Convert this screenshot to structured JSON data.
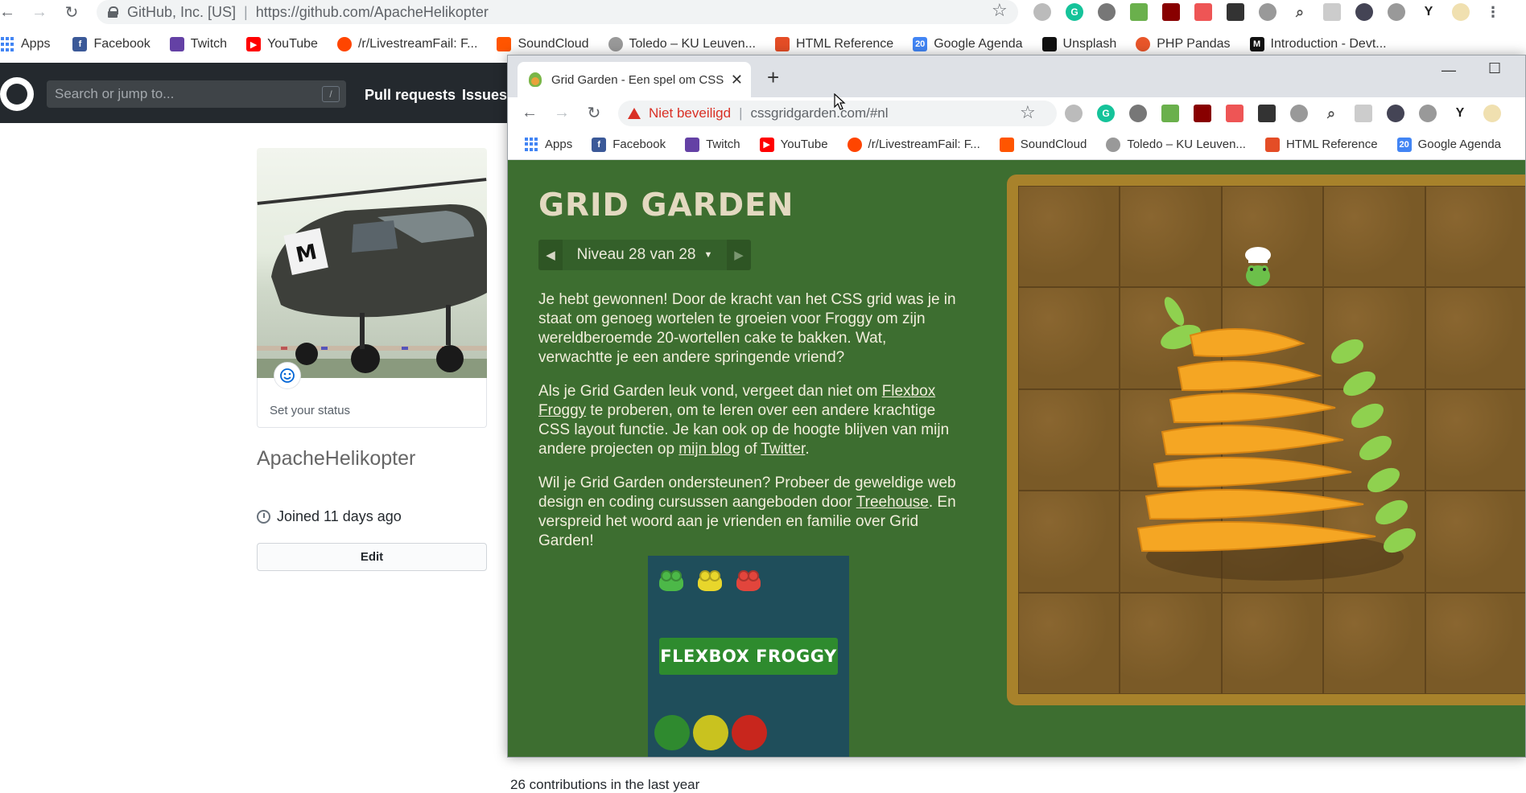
{
  "bg_browser": {
    "omnibox": {
      "site_name": "GitHub, Inc. [US]",
      "url": "https://github.com/ApacheHelikopter"
    },
    "bookmarks": [
      "Apps",
      "Facebook",
      "Twitch",
      "YouTube",
      "/r/LivestreamFail: F...",
      "SoundCloud",
      "Toledo – KU Leuven...",
      "HTML Reference",
      "Google Agenda",
      "Unsplash",
      "PHP Pandas",
      "Introduction - Devt..."
    ]
  },
  "github": {
    "search_placeholder": "Search or jump to...",
    "search_hotkey": "/",
    "nav": [
      "Pull requests",
      "Issues"
    ],
    "set_status": "Set your status",
    "username": "ApacheHelikopter",
    "joined": "Joined 11 days ago",
    "edit_label": "Edit",
    "bottom_text": "26 contributions in the last year"
  },
  "fg_browser": {
    "tab_title": "Grid Garden - Een spel om CSS g",
    "new_tab": "+",
    "not_secure": "Niet beveiligd",
    "url": "cssgridgarden.com/#nl",
    "bookmarks": [
      "Apps",
      "Facebook",
      "Twitch",
      "YouTube",
      "/r/LivestreamFail: F...",
      "SoundCloud",
      "Toledo – KU Leuven...",
      "HTML Reference",
      "Google Agenda"
    ]
  },
  "grid_garden": {
    "title": "GRID GARDEN",
    "level": "Niveau 28 van 28",
    "p1": "Je hebt gewonnen! Door de kracht van het CSS grid was je in staat om genoeg wortelen te groeien voor Froggy om zijn wereldberoemde 20-wortellen cake te bakken. Wat, verwachtte je een andere springende vriend?",
    "p2_before": "Als je Grid Garden leuk vond, vergeet dan niet om ",
    "p2_link1": "Flexbox Froggy",
    "p2_middle": " te proberen, om te leren over een andere krachtige CSS layout functie. Je kan ook op de hoogte blijven van mijn andere projecten op ",
    "p2_link2": "mijn blog",
    "p2_of": " of ",
    "p2_link3": "Twitter",
    "p2_end": ".",
    "p3_before": "Wil je Grid Garden ondersteunen? Probeer de geweldige web design en coding cursussen aangeboden door ",
    "p3_link": "Treehouse",
    "p3_after": ". En verspreid het woord aan je vrienden en familie over Grid Garden!",
    "flexbox_button": "FLEXBOX FROGGY"
  },
  "colors": {
    "garden_bg": "#3d6e30",
    "github_header": "#24292e",
    "not_secure": "#d93025",
    "carrot": "#f5a623"
  }
}
